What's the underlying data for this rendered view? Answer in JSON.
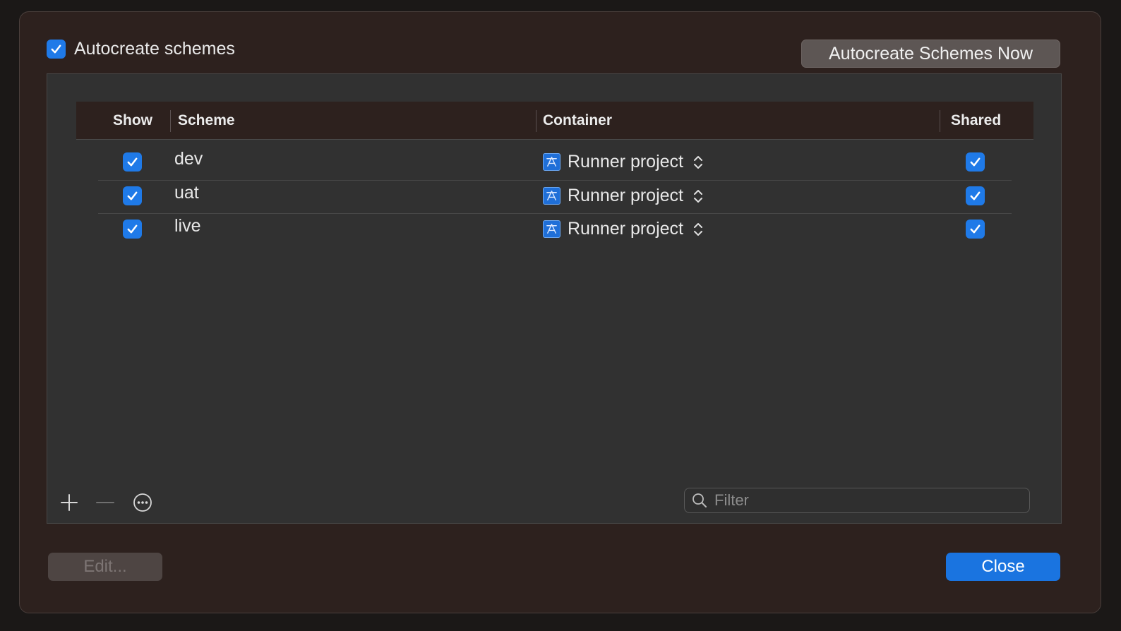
{
  "autocreate": {
    "label": "Autocreate schemes",
    "checked": true,
    "button_label": "Autocreate Schemes Now"
  },
  "table": {
    "columns": {
      "show": "Show",
      "scheme": "Scheme",
      "container": "Container",
      "shared": "Shared"
    },
    "rows": [
      {
        "show": true,
        "scheme": "dev",
        "container": "Runner project",
        "container_icon": "xcode-project-icon",
        "shared": true
      },
      {
        "show": true,
        "scheme": "uat",
        "container": "Runner project",
        "container_icon": "xcode-project-icon",
        "shared": true
      },
      {
        "show": true,
        "scheme": "live",
        "container": "Runner project",
        "container_icon": "xcode-project-icon",
        "shared": true
      }
    ]
  },
  "toolbar": {
    "add_icon": "plus-icon",
    "remove_icon": "minus-icon",
    "more_icon": "ellipsis-circle-icon"
  },
  "filter": {
    "placeholder": "Filter",
    "value": ""
  },
  "footer": {
    "edit_label": "Edit...",
    "close_label": "Close"
  },
  "colors": {
    "accent": "#1a74e0",
    "sheet_bg": "#2d211e",
    "panel_bg": "#313131"
  }
}
